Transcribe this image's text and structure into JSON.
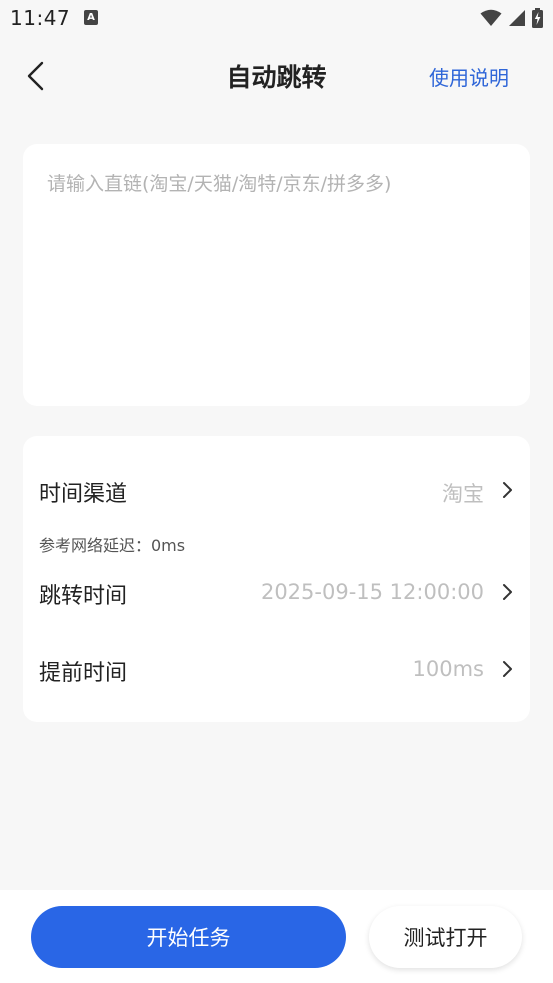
{
  "status_bar": {
    "time": "11:47",
    "notification_glyph": "A",
    "icons": [
      "wifi-icon",
      "cell-signal-icon",
      "battery-charging-icon"
    ]
  },
  "header": {
    "title": "自动跳转",
    "help_label": "使用说明",
    "back_icon": "chevron-left-icon"
  },
  "link_input": {
    "placeholder": "请输入直链(淘宝/天猫/淘特/京东/拼多多)",
    "value": ""
  },
  "settings": {
    "channel": {
      "label": "时间渠道",
      "value": "淘宝"
    },
    "latency_note": "参考网络延迟：0ms",
    "jump_time": {
      "label": "跳转时间",
      "value": "2025-09-15 12:00:00"
    },
    "advance_time": {
      "label": "提前时间",
      "value": "100ms"
    }
  },
  "actions": {
    "start_label": "开始任务",
    "test_label": "测试打开"
  },
  "colors": {
    "accent": "#2966e6",
    "link": "#2f66d8",
    "background": "#f7f7f7",
    "card": "#ffffff",
    "muted_text": "#bfbfbf"
  }
}
